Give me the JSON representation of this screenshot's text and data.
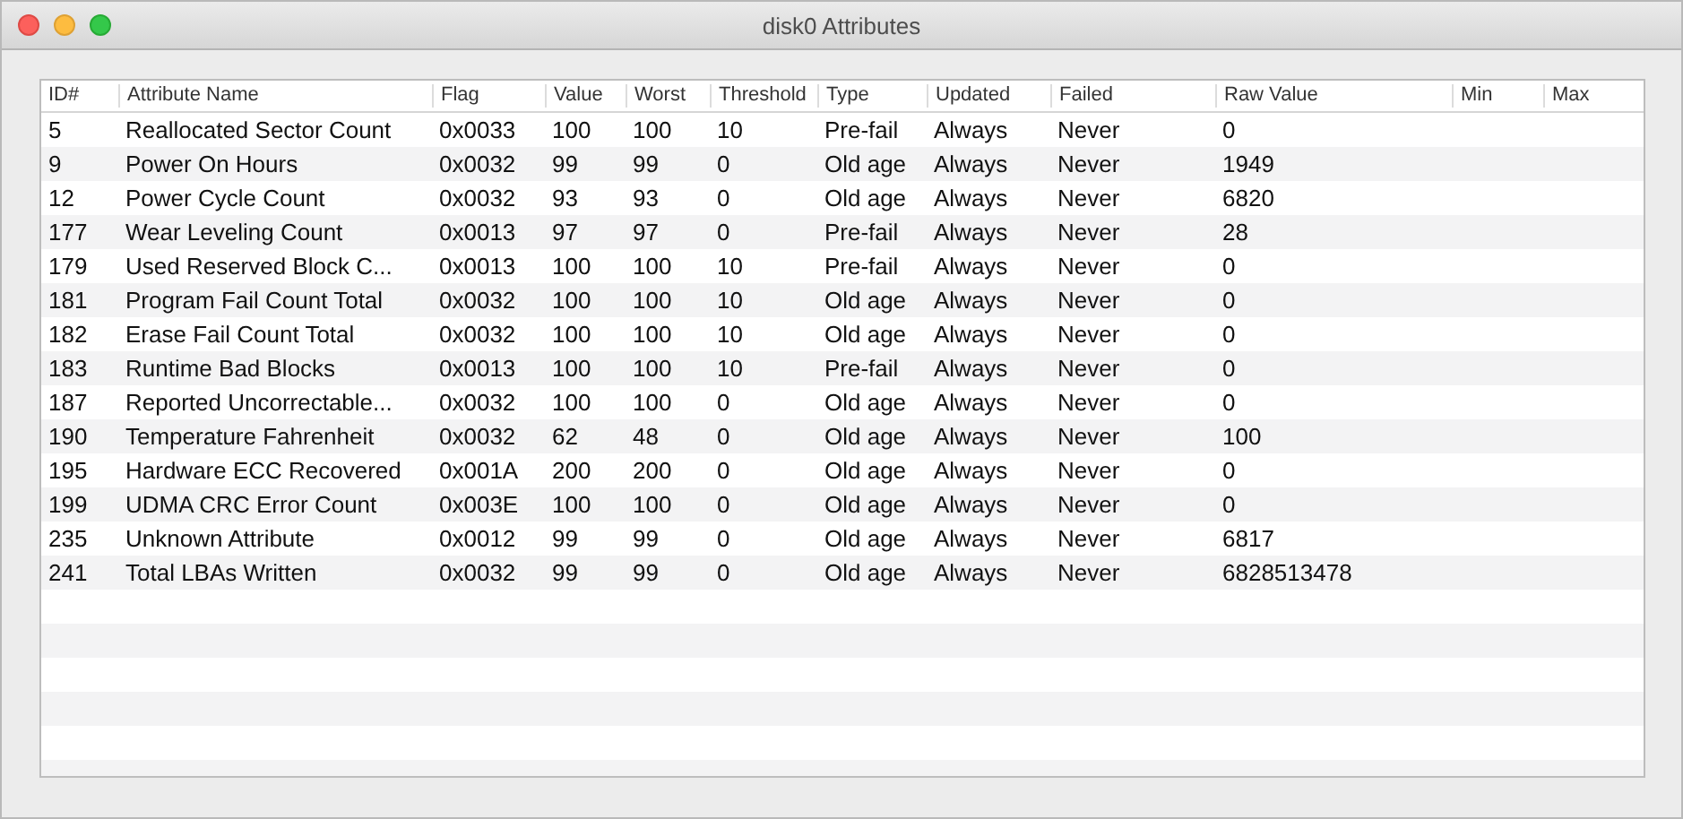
{
  "window": {
    "title": "disk0 Attributes"
  },
  "table": {
    "columns": [
      "ID#",
      "Attribute Name",
      "Flag",
      "Value",
      "Worst",
      "Threshold",
      "Type",
      "Updated",
      "Failed",
      "Raw Value",
      "Min",
      "Max"
    ],
    "rows": [
      [
        "5",
        "Reallocated Sector Count",
        "0x0033",
        "100",
        "100",
        "10",
        "Pre-fail",
        "Always",
        "Never",
        "0"
      ],
      [
        "9",
        "Power On Hours",
        "0x0032",
        "99",
        "99",
        "0",
        "Old age",
        "Always",
        "Never",
        "1949"
      ],
      [
        "12",
        "Power Cycle Count",
        "0x0032",
        "93",
        "93",
        "0",
        "Old age",
        "Always",
        "Never",
        "6820"
      ],
      [
        "177",
        "Wear Leveling Count",
        "0x0013",
        "97",
        "97",
        "0",
        "Pre-fail",
        "Always",
        "Never",
        "28"
      ],
      [
        "179",
        "Used Reserved Block C...",
        "0x0013",
        "100",
        "100",
        "10",
        "Pre-fail",
        "Always",
        "Never",
        "0"
      ],
      [
        "181",
        "Program Fail Count Total",
        "0x0032",
        "100",
        "100",
        "10",
        "Old age",
        "Always",
        "Never",
        "0"
      ],
      [
        "182",
        "Erase Fail Count Total",
        "0x0032",
        "100",
        "100",
        "10",
        "Old age",
        "Always",
        "Never",
        "0"
      ],
      [
        "183",
        "Runtime Bad Blocks",
        "0x0013",
        "100",
        "100",
        "10",
        "Pre-fail",
        "Always",
        "Never",
        "0"
      ],
      [
        "187",
        "Reported Uncorrectable...",
        "0x0032",
        "100",
        "100",
        "0",
        "Old age",
        "Always",
        "Never",
        "0"
      ],
      [
        "190",
        "Temperature Fahrenheit",
        "0x0032",
        "62",
        "48",
        "0",
        "Old age",
        "Always",
        "Never",
        "100"
      ],
      [
        "195",
        "Hardware ECC Recovered",
        "0x001A",
        "200",
        "200",
        "0",
        "Old age",
        "Always",
        "Never",
        "0"
      ],
      [
        "199",
        "UDMA CRC Error Count",
        "0x003E",
        "100",
        "100",
        "0",
        "Old age",
        "Always",
        "Never",
        "0"
      ],
      [
        "235",
        "Unknown Attribute",
        "0x0012",
        "99",
        "99",
        "0",
        "Old age",
        "Always",
        "Never",
        "6817"
      ],
      [
        "241",
        "Total LBAs Written",
        "0x0032",
        "99",
        "99",
        "0",
        "Old age",
        "Always",
        "Never",
        "6828513478"
      ]
    ]
  }
}
